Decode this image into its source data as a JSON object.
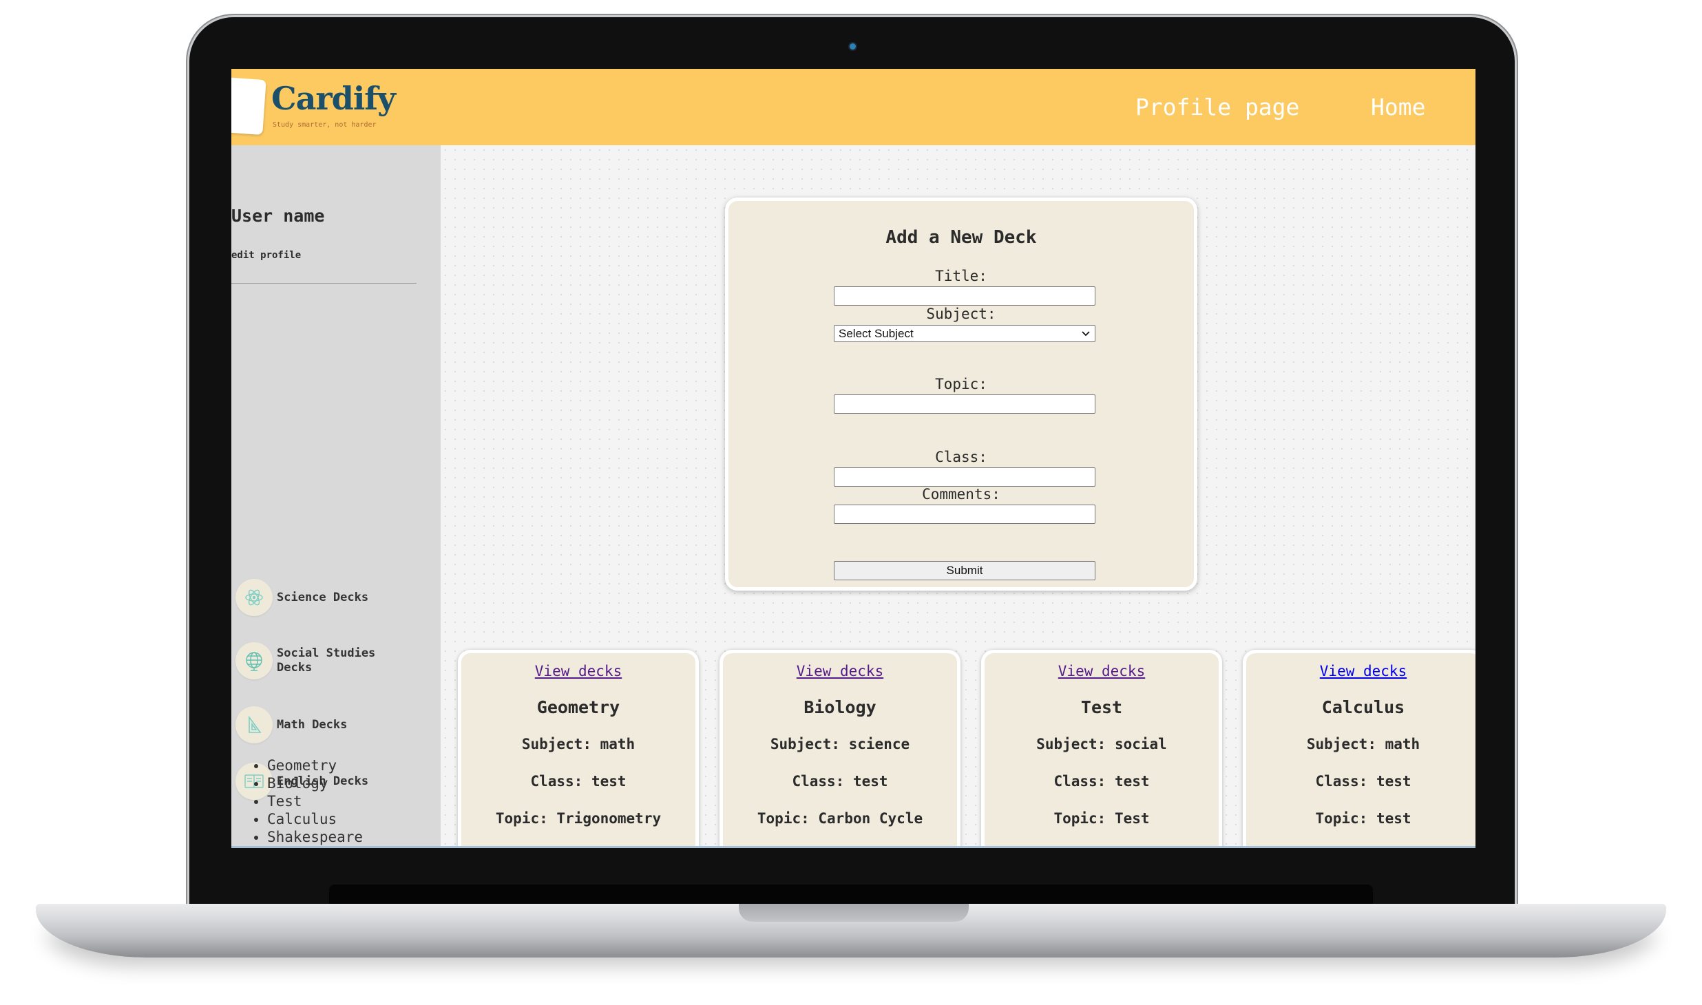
{
  "brand": {
    "name": "Cardify",
    "tagline": "Study smarter, not harder"
  },
  "nav": {
    "profile_label": "Profile page",
    "home_label": "Home"
  },
  "sidebar": {
    "user_name": "User name",
    "edit_profile": "edit profile",
    "categories": [
      {
        "label": "Science Decks",
        "icon": "atom-icon"
      },
      {
        "label": "Social Studies Decks",
        "icon": "globe-icon"
      },
      {
        "label": "Math Decks",
        "icon": "ruler-icon"
      },
      {
        "label": "English Decks",
        "icon": "book-icon"
      }
    ],
    "deck_list": [
      "Geometry",
      "Biology",
      "Test",
      "Calculus",
      "Shakespeare"
    ]
  },
  "form": {
    "heading": "Add a New Deck",
    "title_label": "Title:",
    "subject_label": "Subject:",
    "subject_selected": "Select Subject",
    "topic_label": "Topic:",
    "class_label": "Class:",
    "comments_label": "Comments:",
    "submit_label": "Submit"
  },
  "decks": [
    {
      "link": "View decks",
      "title": "Geometry",
      "subject": "Subject: math",
      "class": "Class: test",
      "topic": "Topic: Trigonometry",
      "link_color": "#551a8b"
    },
    {
      "link": "View decks",
      "title": "Biology",
      "subject": "Subject: science",
      "class": "Class: test",
      "topic": "Topic: Carbon Cycle",
      "link_color": "#551a8b"
    },
    {
      "link": "View decks",
      "title": "Test",
      "subject": "Subject: social",
      "class": "Class: test",
      "topic": "Topic: Test",
      "link_color": "#551a8b"
    },
    {
      "link": "View decks",
      "title": "Calculus",
      "subject": "Subject: math",
      "class": "Class: test",
      "topic": "Topic: test",
      "link_color": "#0000ee"
    }
  ],
  "colors": {
    "navbar": "#fdca62",
    "sidebar": "#d9d9d9",
    "card": "#f0ebdc",
    "brand": "#1c4f6a"
  }
}
